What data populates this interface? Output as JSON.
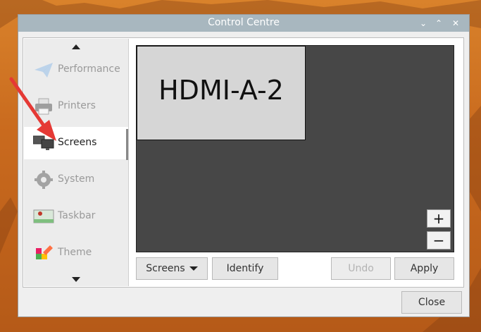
{
  "window": {
    "title": "Control Centre",
    "controls": {
      "minimize": "⌄",
      "maximize": "⌃",
      "close": "✕"
    }
  },
  "sidebar": {
    "items": [
      {
        "label": "Performance",
        "icon": "paper-plane-icon",
        "active": false
      },
      {
        "label": "Printers",
        "icon": "printer-icon",
        "active": false
      },
      {
        "label": "Screens",
        "icon": "monitors-icon",
        "active": true
      },
      {
        "label": "System",
        "icon": "gear-icon",
        "active": false
      },
      {
        "label": "Taskbar",
        "icon": "taskbar-icon",
        "active": false
      },
      {
        "label": "Theme",
        "icon": "theme-icon",
        "active": false
      }
    ]
  },
  "screens": {
    "monitor_label": "HDMI-A-2",
    "zoom_in": "+",
    "zoom_out": "−"
  },
  "toolbar": {
    "screens_menu": "Screens",
    "identify": "Identify",
    "undo": "Undo",
    "apply": "Apply"
  },
  "footer": {
    "close": "Close"
  },
  "colors": {
    "titlebar": "#a8b7bf",
    "canvas": "#474747",
    "annotation_arrow": "#e53935"
  }
}
